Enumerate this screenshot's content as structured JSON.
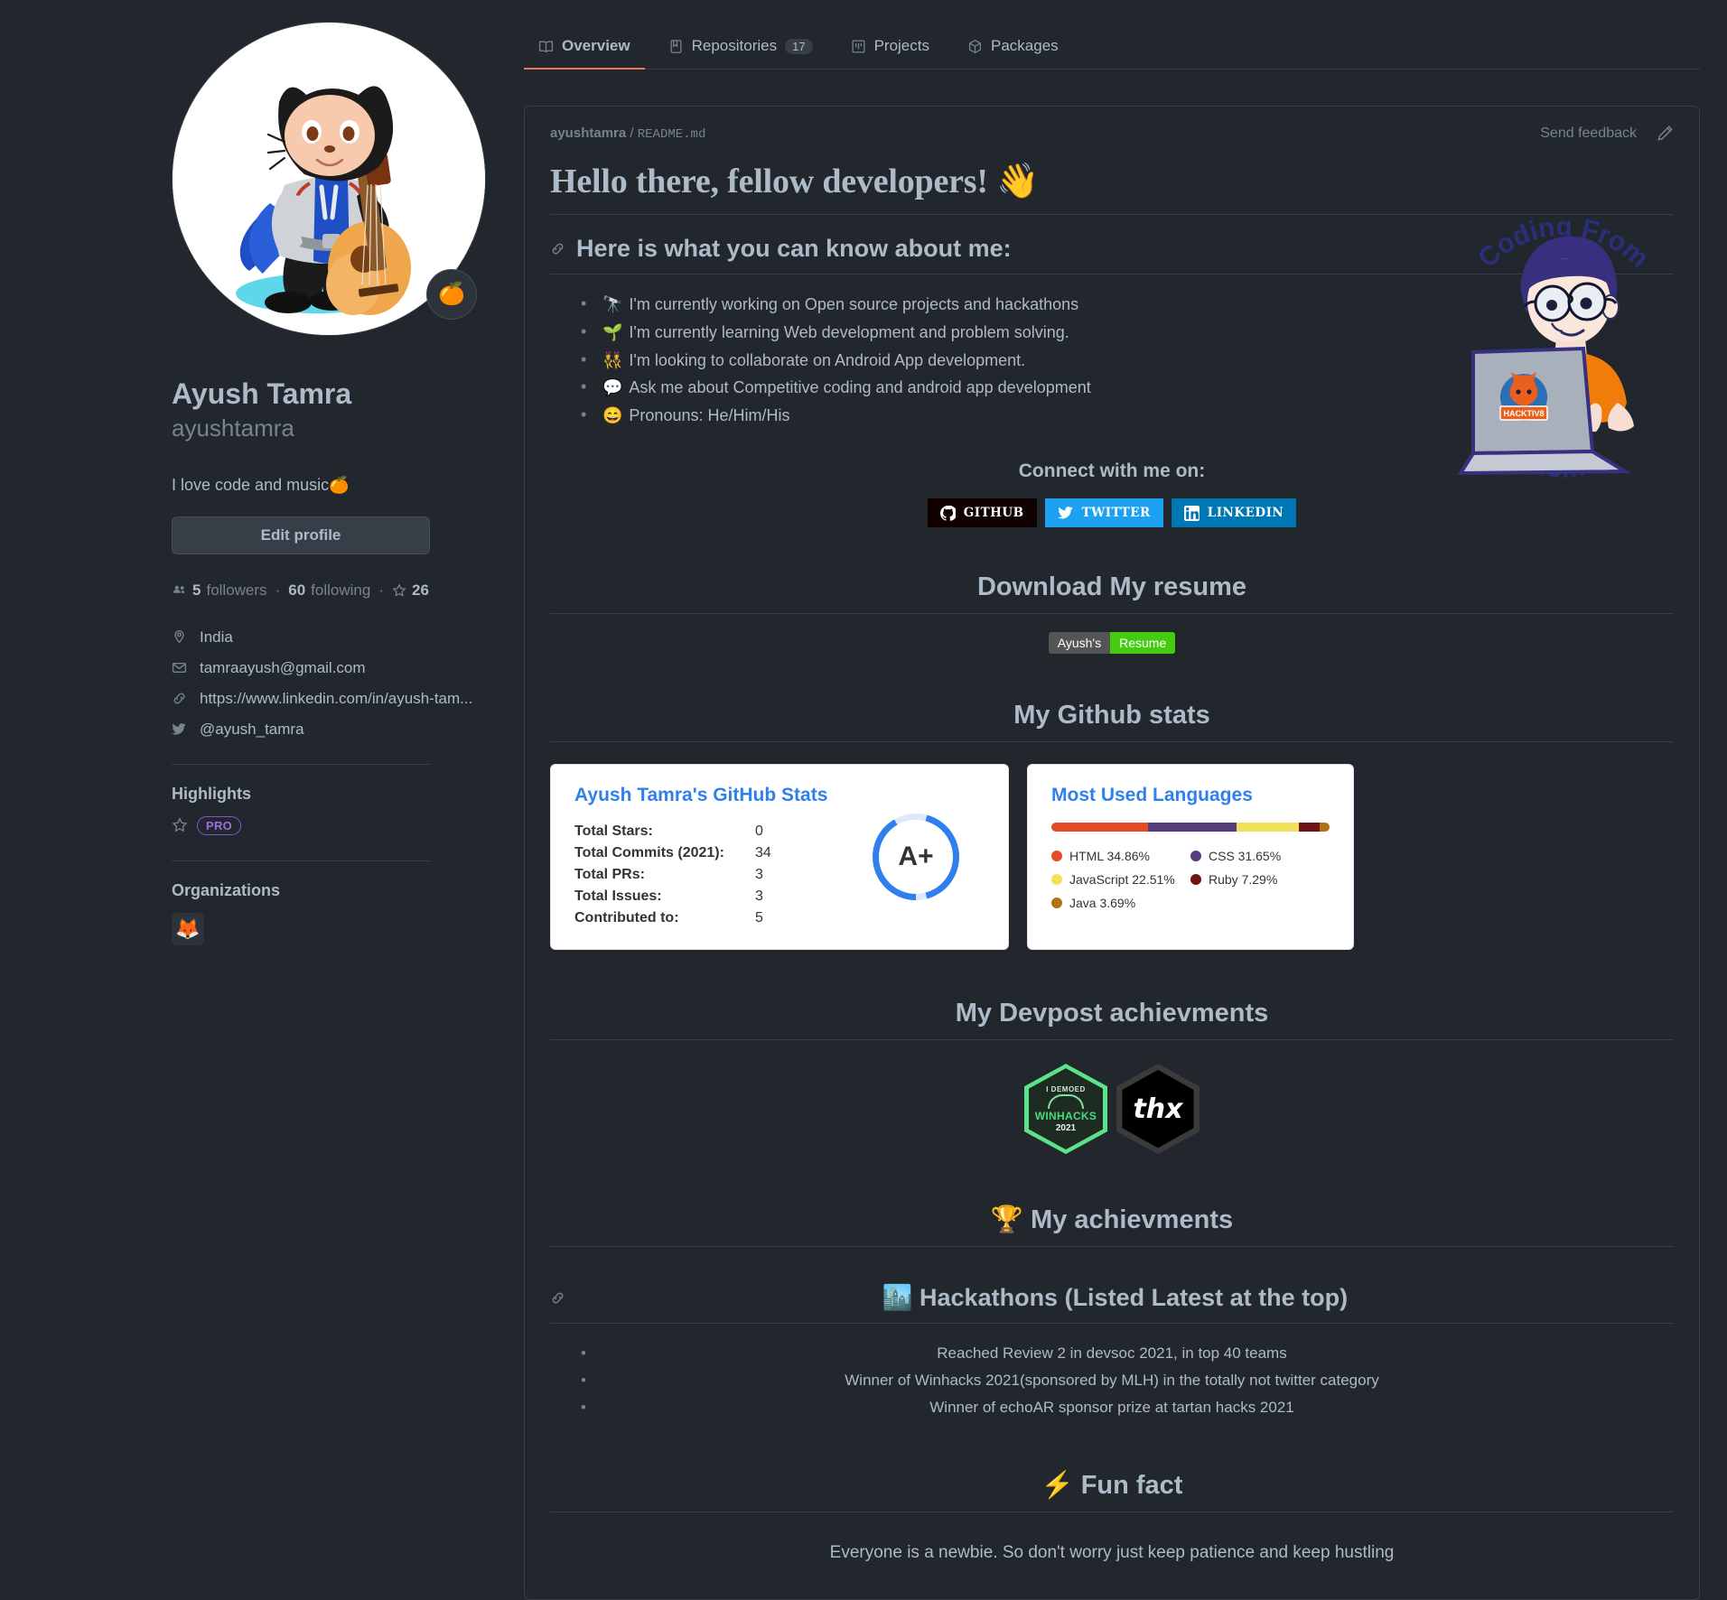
{
  "nav": {
    "tabs": [
      {
        "label": "Overview",
        "icon": "book-icon",
        "count": null,
        "active": true
      },
      {
        "label": "Repositories",
        "icon": "repo-icon",
        "count": "17",
        "active": false
      },
      {
        "label": "Projects",
        "icon": "project-board-icon",
        "count": null,
        "active": false
      },
      {
        "label": "Packages",
        "icon": "package-icon",
        "count": null,
        "active": false
      }
    ]
  },
  "profile": {
    "avatar_emoji": "🐱",
    "status_emoji": "🍊",
    "name": "Ayush Tamra",
    "handle": "ayushtamra",
    "bio": "I love code and music🍊",
    "edit_button": "Edit profile",
    "followers_count": "5",
    "followers_label": "followers",
    "following_count": "60",
    "following_label": "following",
    "stars_count": "26",
    "details": [
      {
        "icon": "location-icon",
        "text": "India"
      },
      {
        "icon": "mail-icon",
        "text": "tamraayush@gmail.com"
      },
      {
        "icon": "link-icon",
        "text": "https://www.linkedin.com/in/ayush-tam..."
      },
      {
        "icon": "twitter-icon",
        "text": "@ayush_tamra"
      }
    ],
    "highlights_title": "Highlights",
    "pro_badge": "PRO",
    "organizations_title": "Organizations",
    "org_emoji": "🦊"
  },
  "readme": {
    "breadcrumb_owner": "ayushtamra",
    "breadcrumb_sep": "/",
    "breadcrumb_file": "README.md",
    "send_feedback": "Send feedback",
    "edit_icon": "pencil-icon",
    "title": "Hello there, fellow developers! 👋",
    "about_heading": "Here is what you can know about me:",
    "about_items": [
      {
        "emoji": "🔭",
        "text": "I'm currently working on Open source projects and hackathons"
      },
      {
        "emoji": "🌱",
        "text": "I'm currently learning Web development and problem solving."
      },
      {
        "emoji": "👯",
        "text": "I'm looking to collaborate on Android App development."
      },
      {
        "emoji": "💬",
        "text": "Ask me about Competitive coding and android app development"
      },
      {
        "emoji": "😄",
        "text": "Pronouns: He/Him/His"
      }
    ],
    "connect_title": "Connect with me on:",
    "social_badges": [
      {
        "label": "GITHUB",
        "icon": "github-icon",
        "bg": "#100000"
      },
      {
        "label": "TWITTER",
        "icon": "twitter-icon",
        "bg": "#1DA1F2"
      },
      {
        "label": "LINKEDIN",
        "icon": "linkedin-icon",
        "bg": "#0077B5"
      }
    ],
    "resume_heading": "Download My resume",
    "resume_badge_left": "Ayush's",
    "resume_badge_right": "Resume",
    "resume_badge_left_color": "#555555",
    "resume_badge_right_color": "#44cc11",
    "stats_heading": "My Github stats",
    "devpost_heading": "My Devpost achievments",
    "devpost_badges": [
      {
        "name": "winhacks-2021-badge",
        "line1": "I DEMOED",
        "line2": "WINHACKS",
        "line3": "2021"
      },
      {
        "name": "thx-badge",
        "text": "thx"
      }
    ],
    "achievements_heading": "🏆 My achievments",
    "hackathons_heading": "🏙️ Hackathons (Listed Latest at the top)",
    "hackathons": [
      "Reached Review 2 in devsoc 2021, in top 40 teams",
      "Winner of Winhacks 2021(sponsored by MLH) in the totally not twitter category",
      "Winner of echoAR sponsor prize at tartan hacks 2021"
    ],
    "funfact_heading": "⚡ Fun fact",
    "funfact_text": "Everyone is a newbie. So don't worry just keep patience and keep hustling",
    "illustration_top_text": "Coding From",
    "illustration_bottom_text": "Home",
    "illustration_laptop_label": "HACKTIV8"
  },
  "chart_data": [
    {
      "type": "table",
      "title": "Ayush Tamra's GitHub Stats",
      "rows": [
        {
          "label": "Total Stars:",
          "value": "0"
        },
        {
          "label": "Total Commits (2021):",
          "value": "34"
        },
        {
          "label": "Total PRs:",
          "value": "3"
        },
        {
          "label": "Total Issues:",
          "value": "3"
        },
        {
          "label": "Contributed to:",
          "value": "5"
        }
      ],
      "rank": "A+",
      "rank_ring_percent": 88,
      "rank_color": "#2f80ed",
      "rank_track_color": "#dce9fb"
    },
    {
      "type": "bar",
      "title": "Most Used Languages",
      "categories": [
        "HTML",
        "CSS",
        "JavaScript",
        "Ruby",
        "Java"
      ],
      "values": [
        34.86,
        31.65,
        22.51,
        7.29,
        3.69
      ],
      "labels": [
        "HTML 34.86%",
        "CSS 31.65%",
        "JavaScript 22.51%",
        "Ruby 7.29%",
        "Java 3.69%"
      ],
      "colors": [
        "#e34c26",
        "#563d7c",
        "#f1e05a",
        "#701516",
        "#b07219"
      ],
      "ylabel": "",
      "xlabel": "",
      "legend_position": "below"
    }
  ]
}
